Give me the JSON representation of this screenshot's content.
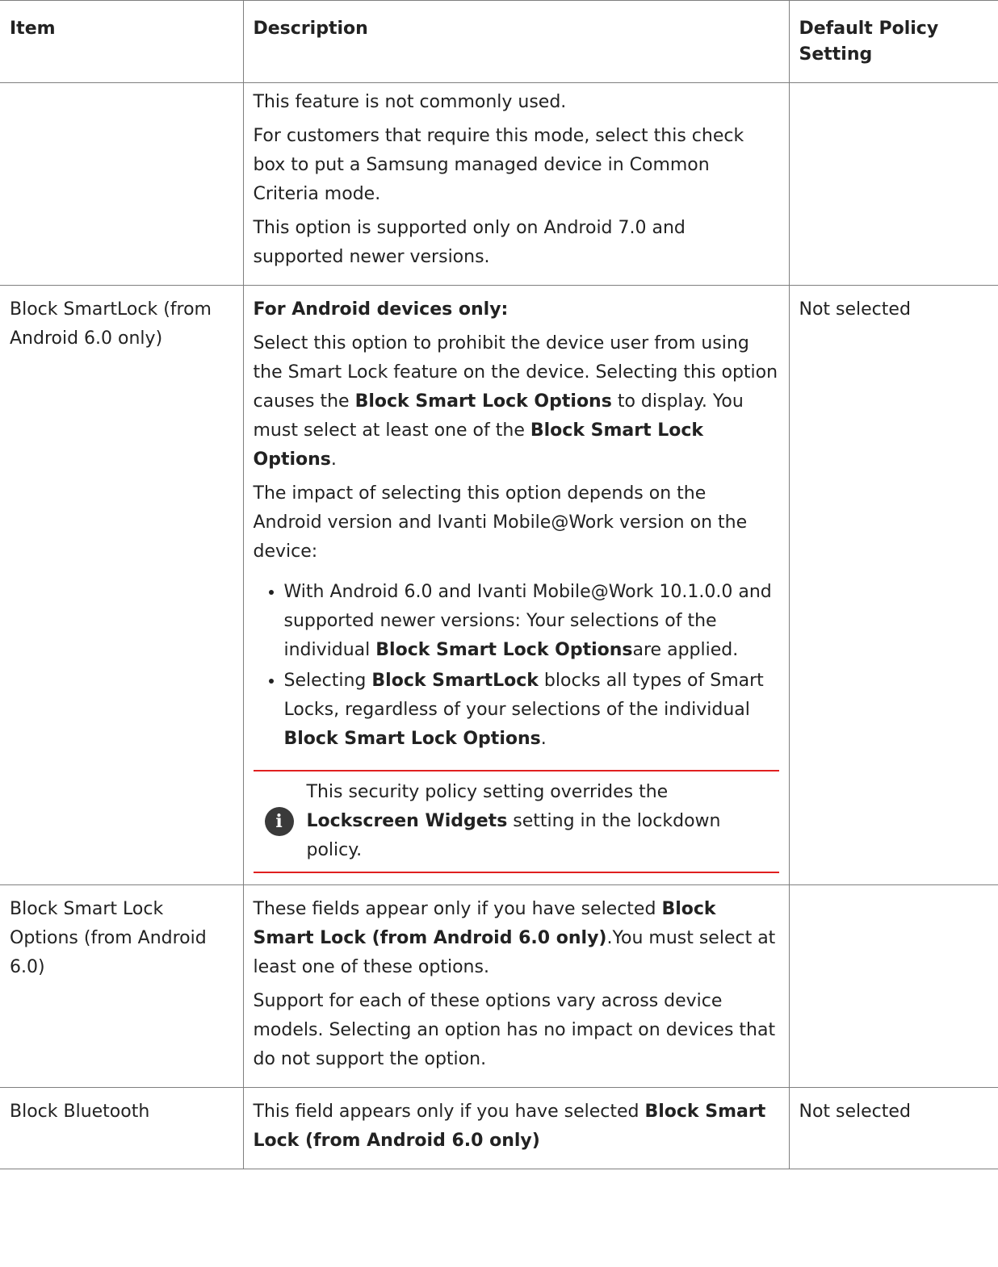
{
  "header": {
    "item": "Item",
    "description": "Description",
    "default": "Default Policy Setting"
  },
  "rows": [
    {
      "item": "",
      "default": "",
      "p1": "This feature is not commonly used.",
      "p2": "For customers that require this mode, select this check box to put a Samsung managed device in Common Criteria mode.",
      "p3": "This option is supported only on Android 7.0 and supported newer versions."
    },
    {
      "item": "Block SmartLock (from Android 6.0 only)",
      "default": "Not selected",
      "p1": "For Android devices only:",
      "p2a": "Select this option to prohibit the device user from using the Smart Lock feature on the device. Selecting this option causes the ",
      "p2b": "Block Smart Lock Options",
      "p2c": " to display. You must select at least one of the ",
      "p2d": "Block Smart Lock Options",
      "p2e": ".",
      "p3": "The impact of selecting this option depends on the Android version and Ivanti Mobile@Work version on the device:",
      "li1a": "With Android 6.0 and Ivanti Mobile@Work 10.1.0.0 and supported newer versions: Your selections of the individual ",
      "li1b": "Block Smart Lock Options",
      "li1c": "are applied.",
      "li2a": "Selecting ",
      "li2b": "Block SmartLock",
      "li2c": " blocks all types of Smart Locks, regardless of your selections of the individual ",
      "li2d": "Block Smart Lock Options",
      "li2e": ".",
      "note_icon": "i",
      "note_a": "This security policy setting overrides the ",
      "note_b": "Lockscreen Widgets",
      "note_c": " setting in the lockdown policy."
    },
    {
      "item": "Block Smart Lock Options (from Android 6.0)",
      "default": "",
      "p1a": "These fields appear only if you have selected ",
      "p1b": "Block Smart Lock (from Android 6.0 only)",
      "p1c": ".You must select at least one of these options.",
      "p2": "Support for each of these options vary across device models. Selecting an option has no impact on devices that do not support the option."
    },
    {
      "item": "Block Bluetooth",
      "default": "Not selected",
      "p1a": "This field appears only if you have selected ",
      "p1b": "Block Smart Lock (from Android 6.0 only)"
    }
  ]
}
